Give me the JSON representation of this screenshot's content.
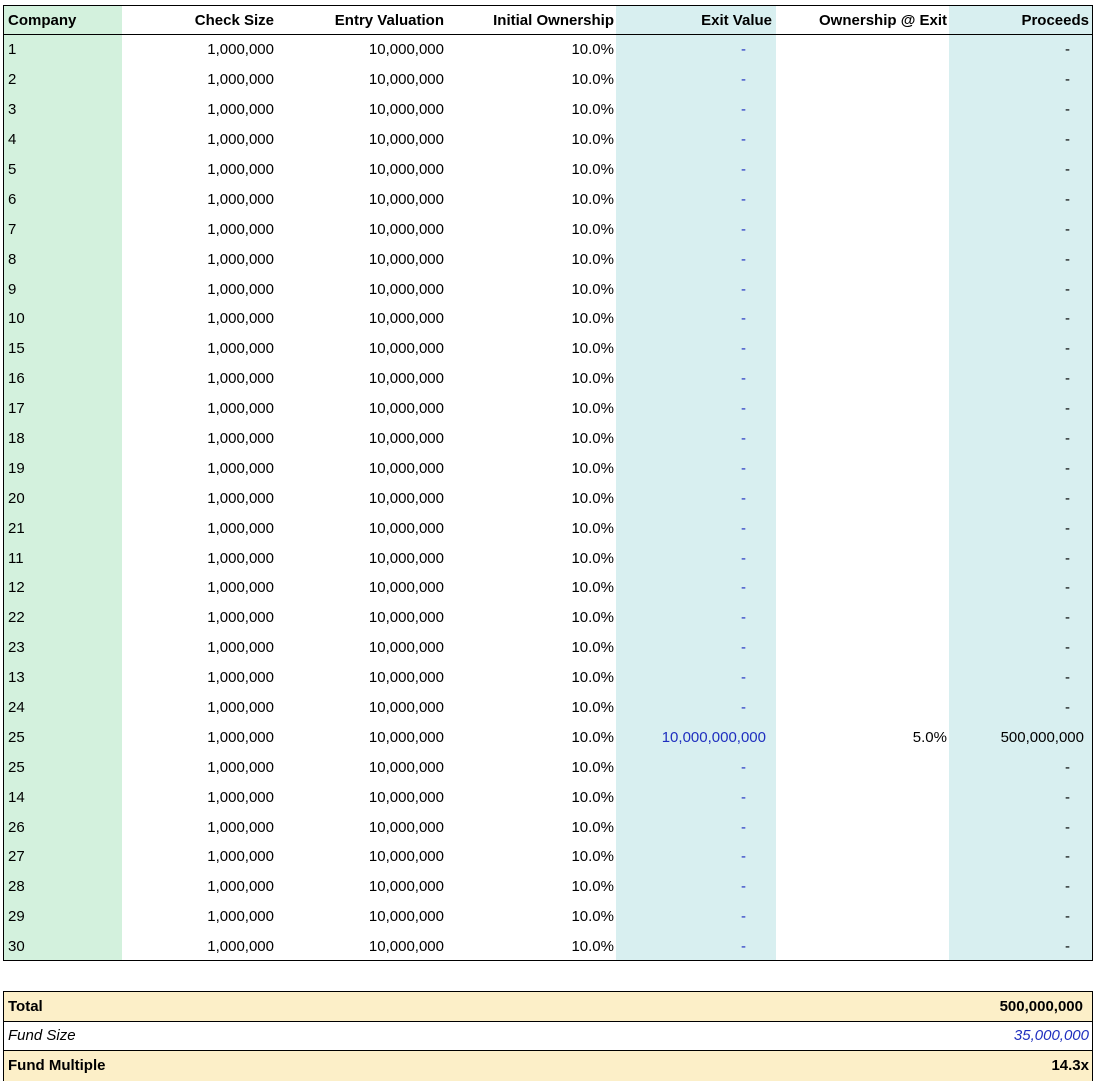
{
  "colors": {
    "company_band": "#d3f1dd",
    "exit_band": "#d8eff0",
    "proceeds_band": "#d8eff0",
    "summary_highlight": "#fcefc8",
    "input_blue": "#1f2fbf"
  },
  "table": {
    "headers": {
      "company": "Company",
      "check_size": "Check Size",
      "entry_valuation": "Entry Valuation",
      "initial_ownership": "Initial Ownership",
      "exit_value": "Exit Value",
      "ownership_at_exit": "Ownership @ Exit",
      "proceeds": "Proceeds"
    },
    "rows": [
      {
        "company": "1",
        "check_size": "1,000,000",
        "entry_valuation": "10,000,000",
        "initial_ownership": "10.0%",
        "exit_value": "-",
        "ownership_at_exit": "",
        "proceeds": "-"
      },
      {
        "company": "2",
        "check_size": "1,000,000",
        "entry_valuation": "10,000,000",
        "initial_ownership": "10.0%",
        "exit_value": "-",
        "ownership_at_exit": "",
        "proceeds": "-"
      },
      {
        "company": "3",
        "check_size": "1,000,000",
        "entry_valuation": "10,000,000",
        "initial_ownership": "10.0%",
        "exit_value": "-",
        "ownership_at_exit": "",
        "proceeds": "-"
      },
      {
        "company": "4",
        "check_size": "1,000,000",
        "entry_valuation": "10,000,000",
        "initial_ownership": "10.0%",
        "exit_value": "-",
        "ownership_at_exit": "",
        "proceeds": "-"
      },
      {
        "company": "5",
        "check_size": "1,000,000",
        "entry_valuation": "10,000,000",
        "initial_ownership": "10.0%",
        "exit_value": "-",
        "ownership_at_exit": "",
        "proceeds": "-"
      },
      {
        "company": "6",
        "check_size": "1,000,000",
        "entry_valuation": "10,000,000",
        "initial_ownership": "10.0%",
        "exit_value": "-",
        "ownership_at_exit": "",
        "proceeds": "-"
      },
      {
        "company": "7",
        "check_size": "1,000,000",
        "entry_valuation": "10,000,000",
        "initial_ownership": "10.0%",
        "exit_value": "-",
        "ownership_at_exit": "",
        "proceeds": "-"
      },
      {
        "company": "8",
        "check_size": "1,000,000",
        "entry_valuation": "10,000,000",
        "initial_ownership": "10.0%",
        "exit_value": "-",
        "ownership_at_exit": "",
        "proceeds": "-"
      },
      {
        "company": "9",
        "check_size": "1,000,000",
        "entry_valuation": "10,000,000",
        "initial_ownership": "10.0%",
        "exit_value": "-",
        "ownership_at_exit": "",
        "proceeds": "-"
      },
      {
        "company": "10",
        "check_size": "1,000,000",
        "entry_valuation": "10,000,000",
        "initial_ownership": "10.0%",
        "exit_value": "-",
        "ownership_at_exit": "",
        "proceeds": "-"
      },
      {
        "company": "15",
        "check_size": "1,000,000",
        "entry_valuation": "10,000,000",
        "initial_ownership": "10.0%",
        "exit_value": "-",
        "ownership_at_exit": "",
        "proceeds": "-"
      },
      {
        "company": "16",
        "check_size": "1,000,000",
        "entry_valuation": "10,000,000",
        "initial_ownership": "10.0%",
        "exit_value": "-",
        "ownership_at_exit": "",
        "proceeds": "-"
      },
      {
        "company": "17",
        "check_size": "1,000,000",
        "entry_valuation": "10,000,000",
        "initial_ownership": "10.0%",
        "exit_value": "-",
        "ownership_at_exit": "",
        "proceeds": "-"
      },
      {
        "company": "18",
        "check_size": "1,000,000",
        "entry_valuation": "10,000,000",
        "initial_ownership": "10.0%",
        "exit_value": "-",
        "ownership_at_exit": "",
        "proceeds": "-"
      },
      {
        "company": "19",
        "check_size": "1,000,000",
        "entry_valuation": "10,000,000",
        "initial_ownership": "10.0%",
        "exit_value": "-",
        "ownership_at_exit": "",
        "proceeds": "-"
      },
      {
        "company": "20",
        "check_size": "1,000,000",
        "entry_valuation": "10,000,000",
        "initial_ownership": "10.0%",
        "exit_value": "-",
        "ownership_at_exit": "",
        "proceeds": "-"
      },
      {
        "company": "21",
        "check_size": "1,000,000",
        "entry_valuation": "10,000,000",
        "initial_ownership": "10.0%",
        "exit_value": "-",
        "ownership_at_exit": "",
        "proceeds": "-"
      },
      {
        "company": "11",
        "check_size": "1,000,000",
        "entry_valuation": "10,000,000",
        "initial_ownership": "10.0%",
        "exit_value": "-",
        "ownership_at_exit": "",
        "proceeds": "-"
      },
      {
        "company": "12",
        "check_size": "1,000,000",
        "entry_valuation": "10,000,000",
        "initial_ownership": "10.0%",
        "exit_value": "-",
        "ownership_at_exit": "",
        "proceeds": "-"
      },
      {
        "company": "22",
        "check_size": "1,000,000",
        "entry_valuation": "10,000,000",
        "initial_ownership": "10.0%",
        "exit_value": "-",
        "ownership_at_exit": "",
        "proceeds": "-"
      },
      {
        "company": "23",
        "check_size": "1,000,000",
        "entry_valuation": "10,000,000",
        "initial_ownership": "10.0%",
        "exit_value": "-",
        "ownership_at_exit": "",
        "proceeds": "-"
      },
      {
        "company": "13",
        "check_size": "1,000,000",
        "entry_valuation": "10,000,000",
        "initial_ownership": "10.0%",
        "exit_value": "-",
        "ownership_at_exit": "",
        "proceeds": "-"
      },
      {
        "company": "24",
        "check_size": "1,000,000",
        "entry_valuation": "10,000,000",
        "initial_ownership": "10.0%",
        "exit_value": "-",
        "ownership_at_exit": "",
        "proceeds": "-"
      },
      {
        "company": "25",
        "check_size": "1,000,000",
        "entry_valuation": "10,000,000",
        "initial_ownership": "10.0%",
        "exit_value": "10,000,000,000",
        "ownership_at_exit": "5.0%",
        "proceeds": "500,000,000"
      },
      {
        "company": "25",
        "check_size": "1,000,000",
        "entry_valuation": "10,000,000",
        "initial_ownership": "10.0%",
        "exit_value": "-",
        "ownership_at_exit": "",
        "proceeds": "-"
      },
      {
        "company": "14",
        "check_size": "1,000,000",
        "entry_valuation": "10,000,000",
        "initial_ownership": "10.0%",
        "exit_value": "-",
        "ownership_at_exit": "",
        "proceeds": "-"
      },
      {
        "company": "26",
        "check_size": "1,000,000",
        "entry_valuation": "10,000,000",
        "initial_ownership": "10.0%",
        "exit_value": "-",
        "ownership_at_exit": "",
        "proceeds": "-"
      },
      {
        "company": "27",
        "check_size": "1,000,000",
        "entry_valuation": "10,000,000",
        "initial_ownership": "10.0%",
        "exit_value": "-",
        "ownership_at_exit": "",
        "proceeds": "-"
      },
      {
        "company": "28",
        "check_size": "1,000,000",
        "entry_valuation": "10,000,000",
        "initial_ownership": "10.0%",
        "exit_value": "-",
        "ownership_at_exit": "",
        "proceeds": "-"
      },
      {
        "company": "29",
        "check_size": "1,000,000",
        "entry_valuation": "10,000,000",
        "initial_ownership": "10.0%",
        "exit_value": "-",
        "ownership_at_exit": "",
        "proceeds": "-"
      },
      {
        "company": "30",
        "check_size": "1,000,000",
        "entry_valuation": "10,000,000",
        "initial_ownership": "10.0%",
        "exit_value": "-",
        "ownership_at_exit": "",
        "proceeds": "-"
      }
    ]
  },
  "summary": {
    "total_label": "Total",
    "total_value": "500,000,000",
    "fund_size_label": "Fund Size",
    "fund_size_value": "35,000,000",
    "fund_multiple_label": "Fund Multiple",
    "fund_multiple_value": "14.3x"
  }
}
